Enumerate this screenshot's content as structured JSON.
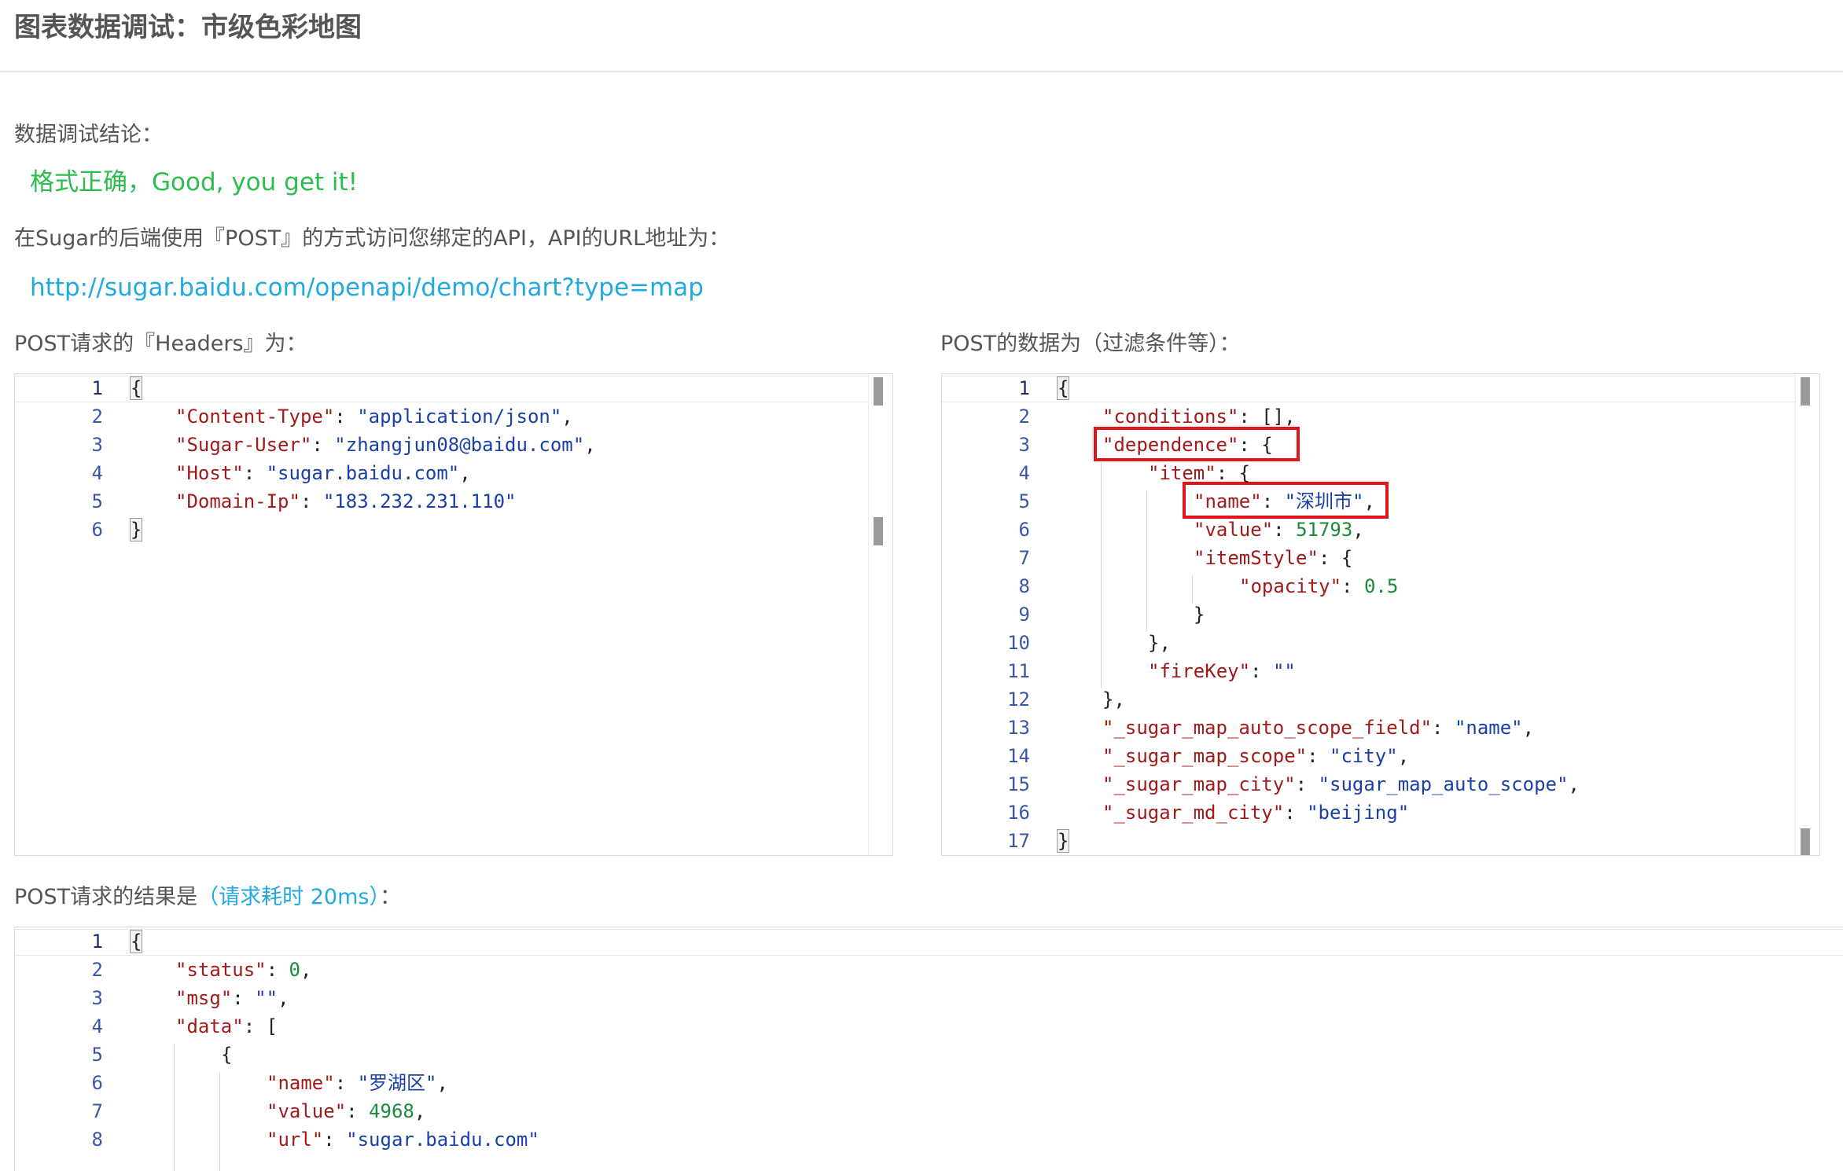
{
  "page_title": "图表数据调试：市级色彩地图",
  "conclusion_label": "数据调试结论：",
  "conclusion_text": "格式正确，Good, you get it!",
  "method_text": "在Sugar的后端使用『POST』的方式访问您绑定的API，API的URL地址为：",
  "api_url": "http://sugar.baidu.com/openapi/demo/chart?type=map",
  "headers_label": "POST请求的『Headers』为：",
  "post_data_label": "POST的数据为（过滤条件等）：",
  "result_label": "POST请求的结果是",
  "result_cost": "（请求耗时 20ms）",
  "result_label_suffix": "：",
  "colors": {
    "key": "#a11a1a",
    "string": "#1a3fa8",
    "number": "#1a8a3a",
    "success": "#2dbc4e",
    "link": "#23a9e0",
    "highlight_box": "#e0151a"
  },
  "headers_editor": {
    "lines": [
      {
        "num": "1",
        "indent": 0,
        "tokens": [
          {
            "t": "p",
            "v": "{"
          }
        ]
      },
      {
        "num": "2",
        "indent": 1,
        "tokens": [
          {
            "t": "k",
            "v": "\"Content-Type\""
          },
          {
            "t": "p",
            "v": ": "
          },
          {
            "t": "s",
            "v": "\"application/json\""
          },
          {
            "t": "p",
            "v": ","
          }
        ]
      },
      {
        "num": "3",
        "indent": 1,
        "tokens": [
          {
            "t": "k",
            "v": "\"Sugar-User\""
          },
          {
            "t": "p",
            "v": ": "
          },
          {
            "t": "s",
            "v": "\"zhangjun08@baidu.com\""
          },
          {
            "t": "p",
            "v": ","
          }
        ]
      },
      {
        "num": "4",
        "indent": 1,
        "tokens": [
          {
            "t": "k",
            "v": "\"Host\""
          },
          {
            "t": "p",
            "v": ": "
          },
          {
            "t": "s",
            "v": "\"sugar.baidu.com\""
          },
          {
            "t": "p",
            "v": ","
          }
        ]
      },
      {
        "num": "5",
        "indent": 1,
        "tokens": [
          {
            "t": "k",
            "v": "\"Domain-Ip\""
          },
          {
            "t": "p",
            "v": ": "
          },
          {
            "t": "s",
            "v": "\"183.232.231.110\""
          }
        ]
      },
      {
        "num": "6",
        "indent": 0,
        "tokens": [
          {
            "t": "p",
            "v": "}"
          }
        ]
      }
    ]
  },
  "post_data_editor": {
    "lines": [
      {
        "num": "1",
        "indent": 0,
        "tokens": [
          {
            "t": "p",
            "v": "{"
          }
        ]
      },
      {
        "num": "2",
        "indent": 1,
        "tokens": [
          {
            "t": "k",
            "v": "\"conditions\""
          },
          {
            "t": "p",
            "v": ": [],"
          }
        ]
      },
      {
        "num": "3",
        "indent": 1,
        "tokens": [
          {
            "t": "k",
            "v": "\"dependence\""
          },
          {
            "t": "p",
            "v": ": {"
          }
        ]
      },
      {
        "num": "4",
        "indent": 2,
        "tokens": [
          {
            "t": "k",
            "v": "\"item\""
          },
          {
            "t": "p",
            "v": ": {"
          }
        ]
      },
      {
        "num": "5",
        "indent": 3,
        "tokens": [
          {
            "t": "k",
            "v": "\"name\""
          },
          {
            "t": "p",
            "v": ": "
          },
          {
            "t": "s",
            "v": "\"深圳市\""
          },
          {
            "t": "p",
            "v": ","
          }
        ]
      },
      {
        "num": "6",
        "indent": 3,
        "tokens": [
          {
            "t": "k",
            "v": "\"value\""
          },
          {
            "t": "p",
            "v": ": "
          },
          {
            "t": "n",
            "v": "51793"
          },
          {
            "t": "p",
            "v": ","
          }
        ]
      },
      {
        "num": "7",
        "indent": 3,
        "tokens": [
          {
            "t": "k",
            "v": "\"itemStyle\""
          },
          {
            "t": "p",
            "v": ": {"
          }
        ]
      },
      {
        "num": "8",
        "indent": 4,
        "tokens": [
          {
            "t": "k",
            "v": "\"opacity\""
          },
          {
            "t": "p",
            "v": ": "
          },
          {
            "t": "n",
            "v": "0.5"
          }
        ]
      },
      {
        "num": "9",
        "indent": 3,
        "tokens": [
          {
            "t": "p",
            "v": "}"
          }
        ]
      },
      {
        "num": "10",
        "indent": 2,
        "tokens": [
          {
            "t": "p",
            "v": "},"
          }
        ]
      },
      {
        "num": "11",
        "indent": 2,
        "tokens": [
          {
            "t": "k",
            "v": "\"fireKey\""
          },
          {
            "t": "p",
            "v": ": "
          },
          {
            "t": "s",
            "v": "\"\""
          }
        ]
      },
      {
        "num": "12",
        "indent": 1,
        "tokens": [
          {
            "t": "p",
            "v": "},"
          }
        ]
      },
      {
        "num": "13",
        "indent": 1,
        "tokens": [
          {
            "t": "k",
            "v": "\"_sugar_map_auto_scope_field\""
          },
          {
            "t": "p",
            "v": ": "
          },
          {
            "t": "s",
            "v": "\"name\""
          },
          {
            "t": "p",
            "v": ","
          }
        ]
      },
      {
        "num": "14",
        "indent": 1,
        "tokens": [
          {
            "t": "k",
            "v": "\"_sugar_map_scope\""
          },
          {
            "t": "p",
            "v": ": "
          },
          {
            "t": "s",
            "v": "\"city\""
          },
          {
            "t": "p",
            "v": ","
          }
        ]
      },
      {
        "num": "15",
        "indent": 1,
        "tokens": [
          {
            "t": "k",
            "v": "\"_sugar_map_city\""
          },
          {
            "t": "p",
            "v": ": "
          },
          {
            "t": "s",
            "v": "\"sugar_map_auto_scope\""
          },
          {
            "t": "p",
            "v": ","
          }
        ]
      },
      {
        "num": "16",
        "indent": 1,
        "tokens": [
          {
            "t": "k",
            "v": "\"_sugar_md_city\""
          },
          {
            "t": "p",
            "v": ": "
          },
          {
            "t": "s",
            "v": "\"beijing\""
          }
        ]
      },
      {
        "num": "17",
        "indent": 0,
        "tokens": [
          {
            "t": "p",
            "v": "}"
          }
        ]
      }
    ]
  },
  "result_editor": {
    "lines": [
      {
        "num": "1",
        "indent": 0,
        "tokens": [
          {
            "t": "p",
            "v": "{"
          }
        ]
      },
      {
        "num": "2",
        "indent": 1,
        "tokens": [
          {
            "t": "k",
            "v": "\"status\""
          },
          {
            "t": "p",
            "v": ": "
          },
          {
            "t": "n",
            "v": "0"
          },
          {
            "t": "p",
            "v": ","
          }
        ]
      },
      {
        "num": "3",
        "indent": 1,
        "tokens": [
          {
            "t": "k",
            "v": "\"msg\""
          },
          {
            "t": "p",
            "v": ": "
          },
          {
            "t": "s",
            "v": "\"\""
          },
          {
            "t": "p",
            "v": ","
          }
        ]
      },
      {
        "num": "4",
        "indent": 1,
        "tokens": [
          {
            "t": "k",
            "v": "\"data\""
          },
          {
            "t": "p",
            "v": ": ["
          }
        ]
      },
      {
        "num": "5",
        "indent": 2,
        "tokens": [
          {
            "t": "p",
            "v": "{"
          }
        ]
      },
      {
        "num": "6",
        "indent": 3,
        "tokens": [
          {
            "t": "k",
            "v": "\"name\""
          },
          {
            "t": "p",
            "v": ": "
          },
          {
            "t": "s",
            "v": "\"罗湖区\""
          },
          {
            "t": "p",
            "v": ","
          }
        ]
      },
      {
        "num": "7",
        "indent": 3,
        "tokens": [
          {
            "t": "k",
            "v": "\"value\""
          },
          {
            "t": "p",
            "v": ": "
          },
          {
            "t": "n",
            "v": "4968"
          },
          {
            "t": "p",
            "v": ","
          }
        ]
      },
      {
        "num": "8",
        "indent": 3,
        "tokens": [
          {
            "t": "k",
            "v": "\"url\""
          },
          {
            "t": "p",
            "v": ": "
          },
          {
            "t": "s",
            "v": "\"sugar.baidu.com\""
          }
        ]
      }
    ]
  }
}
